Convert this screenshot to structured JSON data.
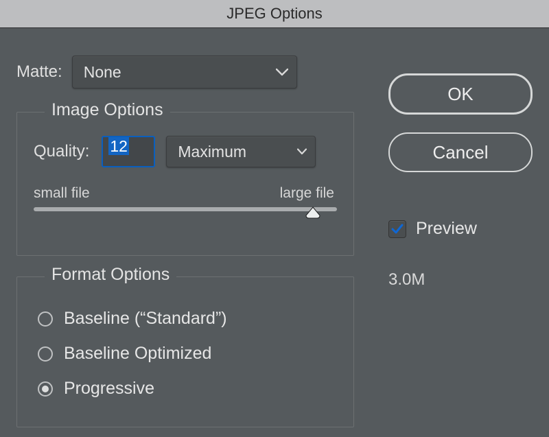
{
  "window": {
    "title": "JPEG Options"
  },
  "matte": {
    "label": "Matte:",
    "value": "None"
  },
  "imageOptions": {
    "legend": "Image Options",
    "qualityLabel": "Quality:",
    "qualityValue": "12",
    "qualityPreset": "Maximum",
    "sliderMinLabel": "small file",
    "sliderMaxLabel": "large file",
    "sliderPercent": 92
  },
  "formatOptions": {
    "legend": "Format Options",
    "opt1": "Baseline (“Standard”)",
    "opt2": "Baseline Optimized",
    "opt3": "Progressive",
    "selected": "opt3"
  },
  "buttons": {
    "ok": "OK",
    "cancel": "Cancel"
  },
  "preview": {
    "label": "Preview",
    "checked": true
  },
  "fileSize": "3.0M"
}
